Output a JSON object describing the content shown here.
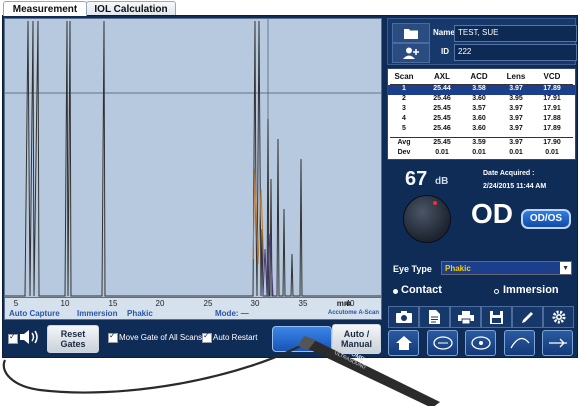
{
  "tabs": [
    {
      "label": "Measurement"
    },
    {
      "label": "IOL Calculation"
    }
  ],
  "patient": {
    "name_label": "Name",
    "name_value": "TEST, SUE",
    "id_label": "ID",
    "id_value": "222"
  },
  "table": {
    "headers": [
      "Scan",
      "AXL",
      "ACD",
      "Lens",
      "VCD"
    ],
    "rows": [
      [
        "1",
        "25.44",
        "3.58",
        "3.97",
        "17.89"
      ],
      [
        "2",
        "25.46",
        "3.60",
        "3.95",
        "17.91"
      ],
      [
        "3",
        "25.45",
        "3.57",
        "3.97",
        "17.91"
      ],
      [
        "4",
        "25.45",
        "3.60",
        "3.97",
        "17.88"
      ],
      [
        "5",
        "25.46",
        "3.60",
        "3.97",
        "17.89"
      ]
    ],
    "summary": [
      [
        "Avg",
        "25.45",
        "3.59",
        "3.97",
        "17.90"
      ],
      [
        "Dev",
        "0.01",
        "0.01",
        "0.01",
        "0.01"
      ]
    ]
  },
  "gain": {
    "value": "67",
    "unit": "dB"
  },
  "date": {
    "label": "Date Acquired :",
    "value": "2/24/2015 11:44 AM"
  },
  "eye": {
    "current": "OD",
    "toggle_label": "OD/OS"
  },
  "eye_type": {
    "label": "Eye Type",
    "value": "Phakic"
  },
  "modes": {
    "contact": "Contact",
    "immersion": "Immersion"
  },
  "scan": {
    "axis_ticks": [
      "5",
      "10",
      "15",
      "20",
      "25",
      "30",
      "35",
      "40"
    ],
    "axis_unit": "mm",
    "status": {
      "capture": "Auto Capture",
      "immersion": "Immersion",
      "phakic": "Phakic",
      "mode": "Mode: —",
      "brand": "Accutome A-Scan"
    }
  },
  "bottom": {
    "reset_gates": "Reset Gates",
    "move_gate": "Move Gate of All Scans",
    "auto_restart": "Auto Restart",
    "auto_manual": "Auto / Manual"
  },
  "probe": {
    "brand_line1": "ACCUTOME",
    "brand_line2": "ULTRASOUND"
  },
  "icons": [
    "folder-icon",
    "add-person-icon",
    "camera-icon",
    "document-icon",
    "printer-icon",
    "save-icon",
    "pen-icon",
    "gear-icon",
    "home-icon",
    "eye-lens-icon-1",
    "eye-lens-icon-2",
    "eye-lens-icon-3",
    "eye-lens-icon-4"
  ],
  "colors": {
    "accent": "#1b3f8a",
    "background": "#0f2c57",
    "scan_bg": "#b7c9de",
    "highlight_text": "#f2d100"
  }
}
